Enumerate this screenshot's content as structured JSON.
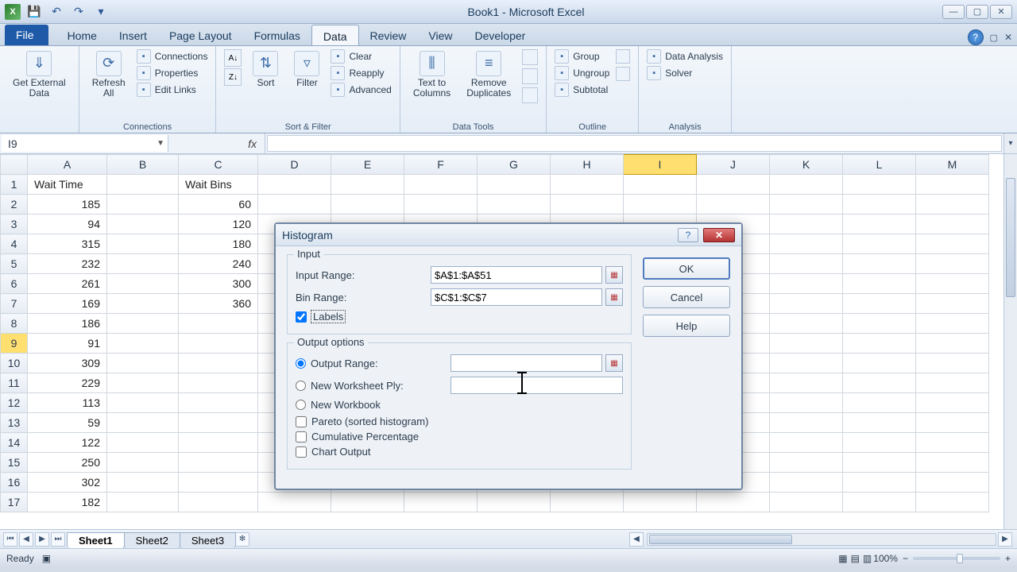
{
  "title": "Book1 - Microsoft Excel",
  "tabs": {
    "file": "File",
    "list": [
      "Home",
      "Insert",
      "Page Layout",
      "Formulas",
      "Data",
      "Review",
      "View",
      "Developer"
    ],
    "active": "Data"
  },
  "ribbon": {
    "get_external": "Get External\nData",
    "refresh": "Refresh\nAll",
    "conn_list": [
      "Connections",
      "Properties",
      "Edit Links"
    ],
    "connections_label": "Connections",
    "sort": "Sort",
    "filter": "Filter",
    "filter_list": [
      "Clear",
      "Reapply",
      "Advanced"
    ],
    "sortfilter_label": "Sort & Filter",
    "text_cols": "Text to\nColumns",
    "remove_dup": "Remove\nDuplicates",
    "datatools_label": "Data Tools",
    "outline_list": [
      "Group",
      "Ungroup",
      "Subtotal"
    ],
    "outline_label": "Outline",
    "analysis_list": [
      "Data Analysis",
      "Solver"
    ],
    "analysis_label": "Analysis"
  },
  "namebox": "I9",
  "fx_label": "fx",
  "columns": [
    "A",
    "B",
    "C",
    "D",
    "E",
    "F",
    "G",
    "H",
    "I",
    "J",
    "K",
    "L",
    "M"
  ],
  "selected_col": "I",
  "selected_row": 9,
  "headers": {
    "A": "Wait Time",
    "C": "Wait Bins"
  },
  "data_A": [
    185,
    94,
    315,
    232,
    261,
    169,
    186,
    91,
    309,
    229,
    113,
    59,
    122,
    250,
    302,
    182
  ],
  "data_C": [
    60,
    120,
    180,
    240,
    300,
    360
  ],
  "sheets": [
    "Sheet1",
    "Sheet2",
    "Sheet3"
  ],
  "active_sheet": "Sheet1",
  "status": {
    "ready": "Ready",
    "zoom": "100%"
  },
  "dialog": {
    "title": "Histogram",
    "input_legend": "Input",
    "input_range_label": "Input Range:",
    "input_range_value": "$A$1:$A$51",
    "bin_range_label": "Bin Range:",
    "bin_range_value": "$C$1:$C$7",
    "labels_label": "Labels",
    "labels_checked": true,
    "output_legend": "Output options",
    "output_range_label": "Output Range:",
    "output_range_value": "",
    "new_ws_label": "New Worksheet Ply:",
    "new_wb_label": "New Workbook",
    "pareto_label": "Pareto (sorted histogram)",
    "cum_label": "Cumulative Percentage",
    "chart_label": "Chart Output",
    "ok": "OK",
    "cancel": "Cancel",
    "help": "Help"
  }
}
